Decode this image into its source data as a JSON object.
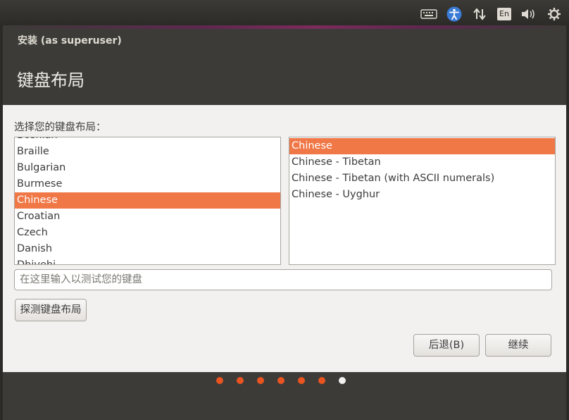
{
  "panel": {
    "icons": [
      "keyboard-icon",
      "accessibility-icon",
      "network-transfer-icon",
      "language-indicator",
      "volume-icon",
      "settings-gear-icon"
    ],
    "language_label": "En"
  },
  "window": {
    "title": "安装 (as superuser)",
    "header": "键盘布局"
  },
  "content": {
    "prompt": "选择您的键盘布局：",
    "layouts": [
      "Bosnian",
      "Braille",
      "Bulgarian",
      "Burmese",
      "Chinese",
      "Croatian",
      "Czech",
      "Danish",
      "Dhivehi"
    ],
    "selected_layout": "Chinese",
    "variants": [
      "Chinese",
      "Chinese - Tibetan",
      "Chinese - Tibetan (with ASCII numerals)",
      "Chinese - Uyghur"
    ],
    "selected_variant": "Chinese",
    "test_placeholder": "在这里输入以测试您的键盘",
    "detect_button": "探测键盘布局",
    "back_button": "后退(B)",
    "continue_button": "继续"
  },
  "progress": {
    "steps_total": 7,
    "current_step": 7
  },
  "colors": {
    "accent": "#f07746",
    "header_bg": "#3c3b37",
    "content_bg": "#f2f1f0",
    "dot_done": "#e95420",
    "dot_current": "#f2f1f0"
  }
}
